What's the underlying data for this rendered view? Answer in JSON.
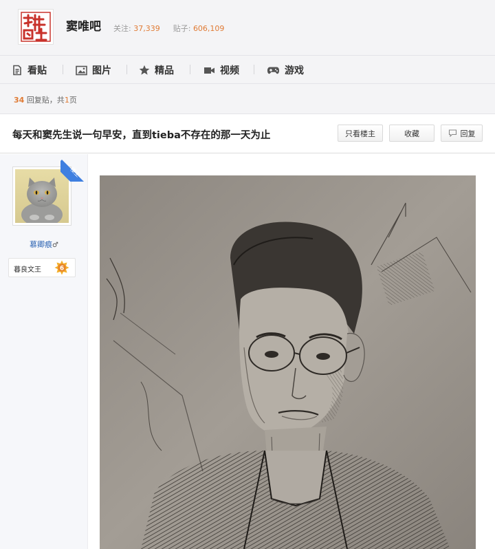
{
  "forum": {
    "name": "窦唯吧",
    "followers_label": "关注:",
    "followers": "37,339",
    "posts_label": "贴子:",
    "posts": "606,109"
  },
  "nav": {
    "items": [
      {
        "label": "看贴",
        "icon": "document-icon"
      },
      {
        "label": "图片",
        "icon": "picture-icon"
      },
      {
        "label": "精品",
        "icon": "star-icon"
      },
      {
        "label": "视频",
        "icon": "video-icon"
      },
      {
        "label": "游戏",
        "icon": "gamepad-icon"
      }
    ]
  },
  "thread": {
    "reply_count": "34",
    "reply_text": "回复贴，共",
    "page_count": "1",
    "page_unit": "页",
    "title": "每天和窦先生说一句早安，直到tieba不存在的那一天为止",
    "buttons": {
      "only_op": "只看楼主",
      "favorite": "收藏",
      "reply": "回复"
    }
  },
  "post": {
    "owner_tag": "楼主",
    "username": "慕卿痕",
    "gender_symbol": "♂",
    "badge_title": "暮良文王",
    "badge_level": "6"
  },
  "colors": {
    "accent_orange": "#e07b35",
    "link_blue": "#2d64b3",
    "owner_ribbon": "#3f7fe0"
  }
}
